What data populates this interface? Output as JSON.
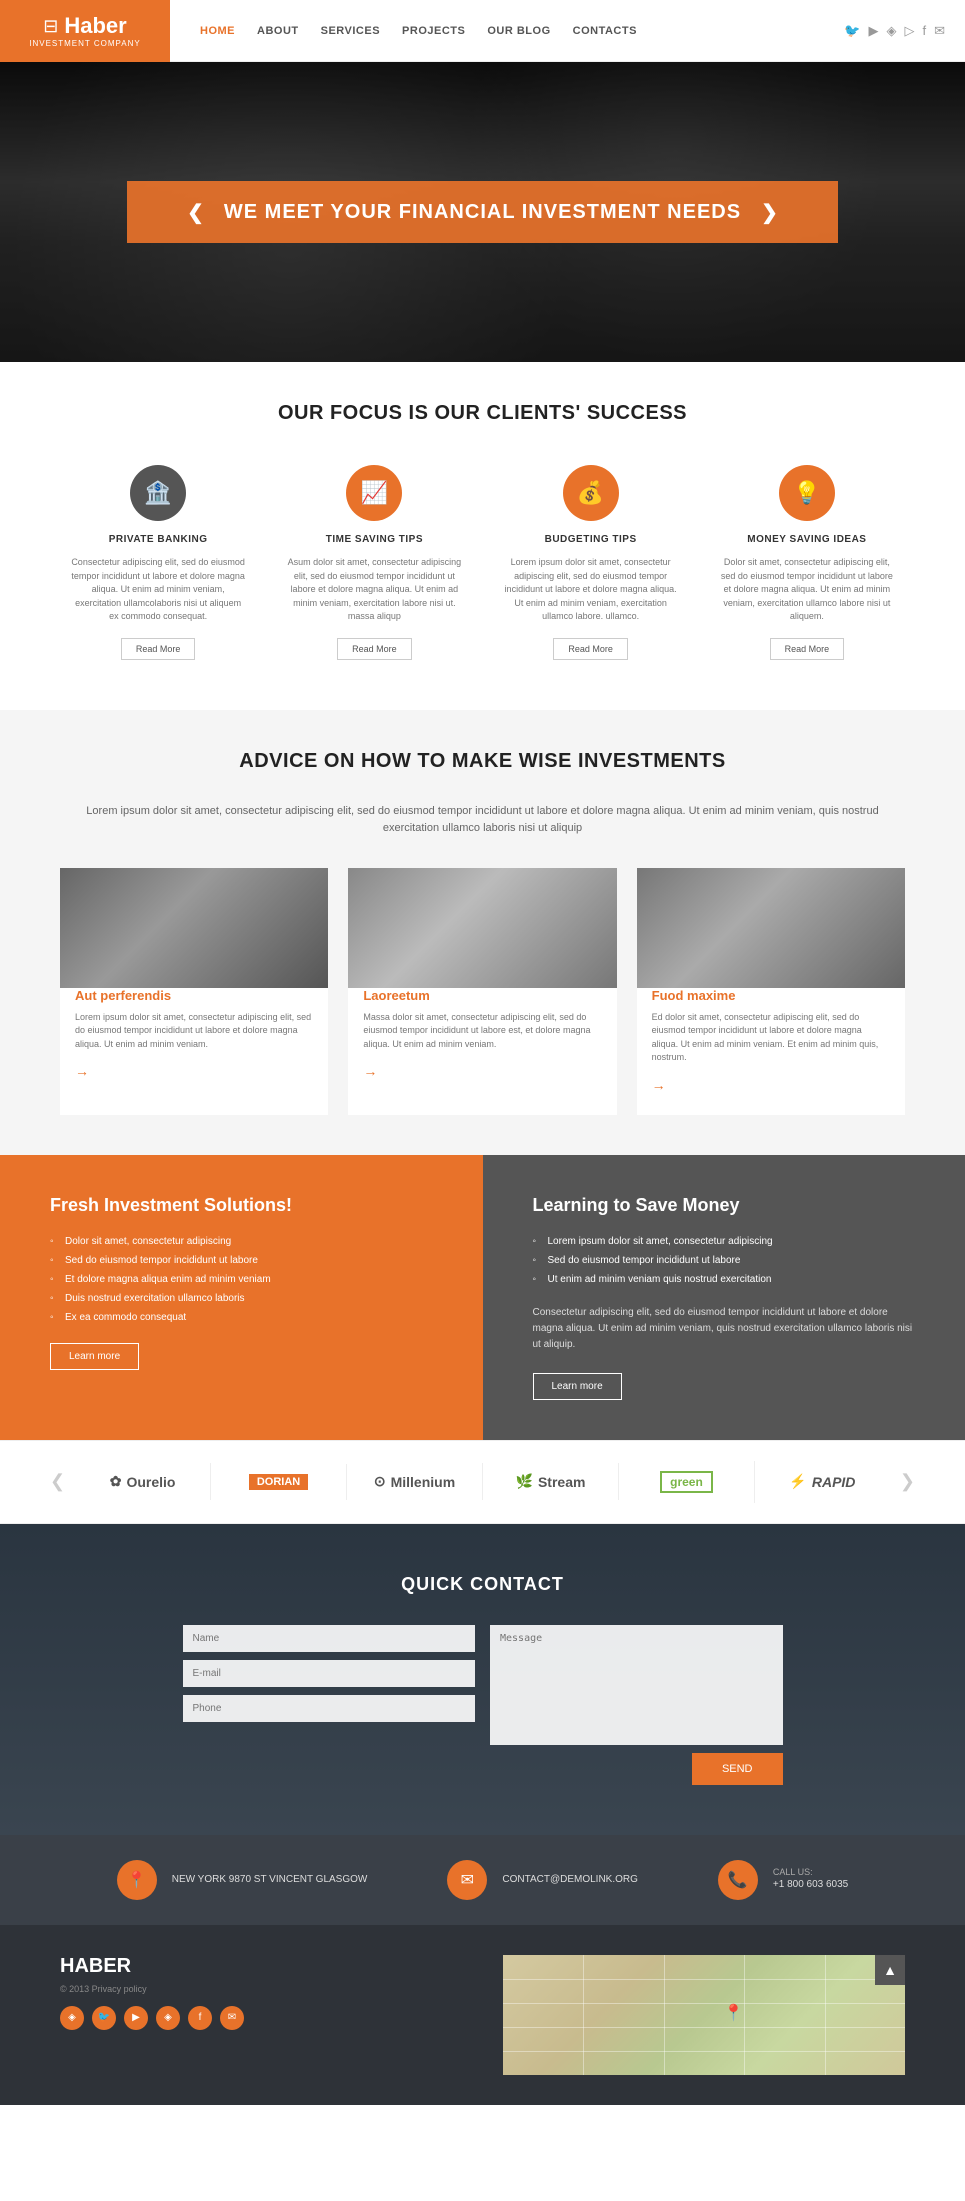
{
  "header": {
    "logo": {
      "icon": "⊟",
      "name": "Haber",
      "sub": "INVESTMENT COMPANY"
    },
    "nav": [
      {
        "label": "HOME",
        "active": true
      },
      {
        "label": "ABOUT",
        "active": false
      },
      {
        "label": "SERVICES",
        "active": false
      },
      {
        "label": "PROJECTS",
        "active": false
      },
      {
        "label": "OUR BLOG",
        "active": false
      },
      {
        "label": "CONTACTS",
        "active": false
      }
    ],
    "social_icons": [
      "🐦",
      "▶",
      "◈",
      "▷",
      "f",
      "✉"
    ]
  },
  "hero": {
    "title": "WE MEET YOUR FINANCIAL INVESTMENT NEEDS",
    "prev_arrow": "❮",
    "next_arrow": "❯"
  },
  "focus": {
    "section_title": "OUR FOCUS IS OUR CLIENTS' SUCCESS",
    "features": [
      {
        "icon": "🏦",
        "title": "PRIVATE\nBANKING",
        "desc": "Consectetur adipiscing elit, sed do eiusmod tempor incididunt ut labore et dolore magna aliqua. Ut enim ad minim veniam, exercitation ullamcolaboris nisi ut aliquem ex commodo consequat.",
        "button": "Read More",
        "icon_color": "gray"
      },
      {
        "icon": "📈",
        "title": "TIME SAVING\nTIPS",
        "desc": "Asum dolor sit amet, consectetur adipiscing elit, sed do eiusmod tempor incididunt ut labore et dolore magna aliqua. Ut enim ad minim veniam, exercitation labore nisi ut. massa aliqup",
        "button": "Read More",
        "icon_color": "orange"
      },
      {
        "icon": "💰",
        "title": "BUDGETING\nTIPS",
        "desc": "Lorem ipsum dolor sit amet, consectetur adipiscing elit, sed do eiusmod tempor incididunt ut labore et dolore magna aliqua. Ut enim ad minim veniam, exercitation ullamco labore. ullamco.",
        "button": "Read More",
        "icon_color": "orange"
      },
      {
        "icon": "💡",
        "title": "MONEY SAVING\nIDEAS",
        "desc": "Dolor sit amet, consectetur adipiscing elit, sed do eiusmod tempor incididunt ut labore et dolore magna aliqua. Ut enim ad minim veniam, exercitation ullamco labore nisi ut aliquem.",
        "button": "Read More",
        "icon_color": "orange"
      }
    ]
  },
  "advice": {
    "section_title": "ADVICE ON HOW TO MAKE WISE INVESTMENTS",
    "desc": "Lorem ipsum dolor sit amet, consectetur adipiscing elit, sed do eiusmod tempor incididunt ut labore et dolore magna aliqua. Ut enim ad minim veniam, quis nostrud exercitation ullamco laboris nisi ut aliquip",
    "cards": [
      {
        "title": "Aut perferendis",
        "desc": "Lorem ipsum dolor sit amet, consectetur adipiscing elit, sed do eiusmod tempor incididunt ut labore et dolore magna aliqua. Ut enim ad minim veniam.",
        "link_icon": "→"
      },
      {
        "title": "Laoreetum",
        "desc": "Massa dolor sit amet, consectetur adipiscing elit, sed do eiusmod tempor incididunt ut labore est, et dolore magna aliqua. Ut enim ad minim veniam.",
        "link_icon": "→"
      },
      {
        "title": "Fuod maxime",
        "desc": "Ed dolor sit amet, consectetur adipiscing elit, sed do eiusmod tempor incididunt ut labore et dolore magna aliqua. Ut enim ad minim veniam. Et enim ad minim quis, nostrum.",
        "link_icon": "→"
      }
    ]
  },
  "cta": {
    "left": {
      "title": "Fresh Investment Solutions!",
      "items": [
        "Dolor sit amet, consectetur adipiscing",
        "Sed do eiusmod tempor incididunt ut labore",
        "Et dolore magna aliqua enim ad minim veniam",
        "Duis nostrud exercitation ullamco laboris",
        "Ex ea commodo consequat"
      ],
      "button": "Learn more"
    },
    "right": {
      "title": "Learning to Save Money",
      "items": [
        "Lorem ipsum dolor sit amet, consectetur adipiscing",
        "Sed do eiusmod tempor incididunt ut labore",
        "Ut enim ad minim veniam quis nostrud exercitation"
      ],
      "desc": "Consectetur adipiscing elit, sed do eiusmod tempor incididunt ut labore et dolore magna aliqua. Ut enim ad minim veniam, quis nostrud exercitation ullamco laboris nisi ut aliquip.",
      "button": "Learn more"
    }
  },
  "brands": {
    "prev": "❮",
    "next": "❯",
    "items": [
      {
        "name": "Ourelio",
        "icon": "✿"
      },
      {
        "name": "DORIAN",
        "icon": "◈"
      },
      {
        "name": "Millenium",
        "icon": "⊙"
      },
      {
        "name": "Stream",
        "icon": "🌿"
      },
      {
        "name": "green",
        "icon": ""
      },
      {
        "name": "RAPID",
        "icon": "⚡"
      }
    ]
  },
  "contact_section": {
    "title": "QUICK CONTACT",
    "form": {
      "name_placeholder": "Name",
      "email_placeholder": "E-mail",
      "phone_placeholder": "Phone",
      "message_placeholder": "Message",
      "send_button": "SEND"
    }
  },
  "contact_info": {
    "items": [
      {
        "icon": "📍",
        "label": "",
        "text": "NEW YORK 9870 ST VINCENT\nGLASGOW"
      },
      {
        "icon": "✉",
        "label": "",
        "text": "CONTACT@DEMOLINK.ORG"
      },
      {
        "icon": "📞",
        "label": "CALL US:",
        "text": "+1 800 603 6035"
      }
    ]
  },
  "footer": {
    "logo": "HABER",
    "copyright": "© 2013  Privacy policy",
    "social_icons": [
      "◈",
      "🐦",
      "▶",
      "◈",
      "f",
      "✉"
    ],
    "map_marker": "📍"
  }
}
